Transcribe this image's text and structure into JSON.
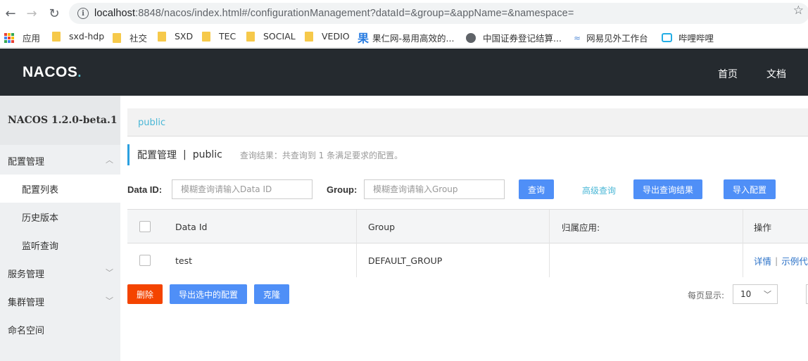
{
  "browser": {
    "url_host": "localhost",
    "url_rest": ":8848/nacos/index.html#/configurationManagement?dataId=&group=&appName=&namespace=",
    "bookmarks": [
      {
        "label": "应用",
        "icon": "apps-grid-icon"
      },
      {
        "label": "sxd-hdp",
        "icon": "folder-icon"
      },
      {
        "label": "社交",
        "icon": "folder-icon"
      },
      {
        "label": "SXD",
        "icon": "folder-icon"
      },
      {
        "label": "TEC",
        "icon": "folder-icon"
      },
      {
        "label": "SOCIAL",
        "icon": "folder-icon"
      },
      {
        "label": "VEDIO",
        "icon": "folder-icon"
      },
      {
        "label": "果仁网-易用高效的...",
        "icon": "guoren-icon"
      },
      {
        "label": "中国证券登记结算...",
        "icon": "globe-icon"
      },
      {
        "label": "网易见外工作台",
        "icon": "netease-icon"
      },
      {
        "label": "哔哩哔哩",
        "icon": "bilibili-icon"
      }
    ]
  },
  "header": {
    "logo": "NACOS",
    "nav": [
      "首页",
      "文档"
    ]
  },
  "sidebar": {
    "version": "NACOS 1.2.0-beta.1",
    "items": [
      {
        "label": "配置管理",
        "sub": false,
        "chevron": "up"
      },
      {
        "label": "配置列表",
        "sub": true,
        "active": true
      },
      {
        "label": "历史版本",
        "sub": true
      },
      {
        "label": "监听查询",
        "sub": true
      },
      {
        "label": "服务管理",
        "sub": false,
        "chevron": "down"
      },
      {
        "label": "集群管理",
        "sub": false,
        "chevron": "down"
      },
      {
        "label": "命名空间",
        "sub": false
      }
    ]
  },
  "main": {
    "namespace_tab": "public",
    "title": "配置管理",
    "separator": "|",
    "title_ns": "public",
    "result_hint": "查询结果：共查询到 1 条满足要求的配置。",
    "dataid_label": "Data ID:",
    "dataid_placeholder": "模糊查询请输入Data ID",
    "group_label": "Group:",
    "group_placeholder": "模糊查询请输入Group",
    "query_button": "查询",
    "advanced_query": "高级查询",
    "export_result_button": "导出查询结果",
    "import_button": "导入配置",
    "table": {
      "columns": [
        "Data Id",
        "Group",
        "归属应用:",
        "操作"
      ],
      "rows": [
        {
          "data_id": "test",
          "group": "DEFAULT_GROUP",
          "app": "",
          "ops": [
            "详情",
            "示例代码"
          ]
        }
      ]
    },
    "delete_button": "删除",
    "export_selected_button": "导出选中的配置",
    "clone_button": "克隆",
    "page_size_label": "每页显示:",
    "page_size": "10"
  },
  "colors": {
    "header_bg": "#252a2f",
    "accent_blue": "#4f8ff7",
    "danger": "#f44400",
    "link": "#4ab7d6"
  }
}
